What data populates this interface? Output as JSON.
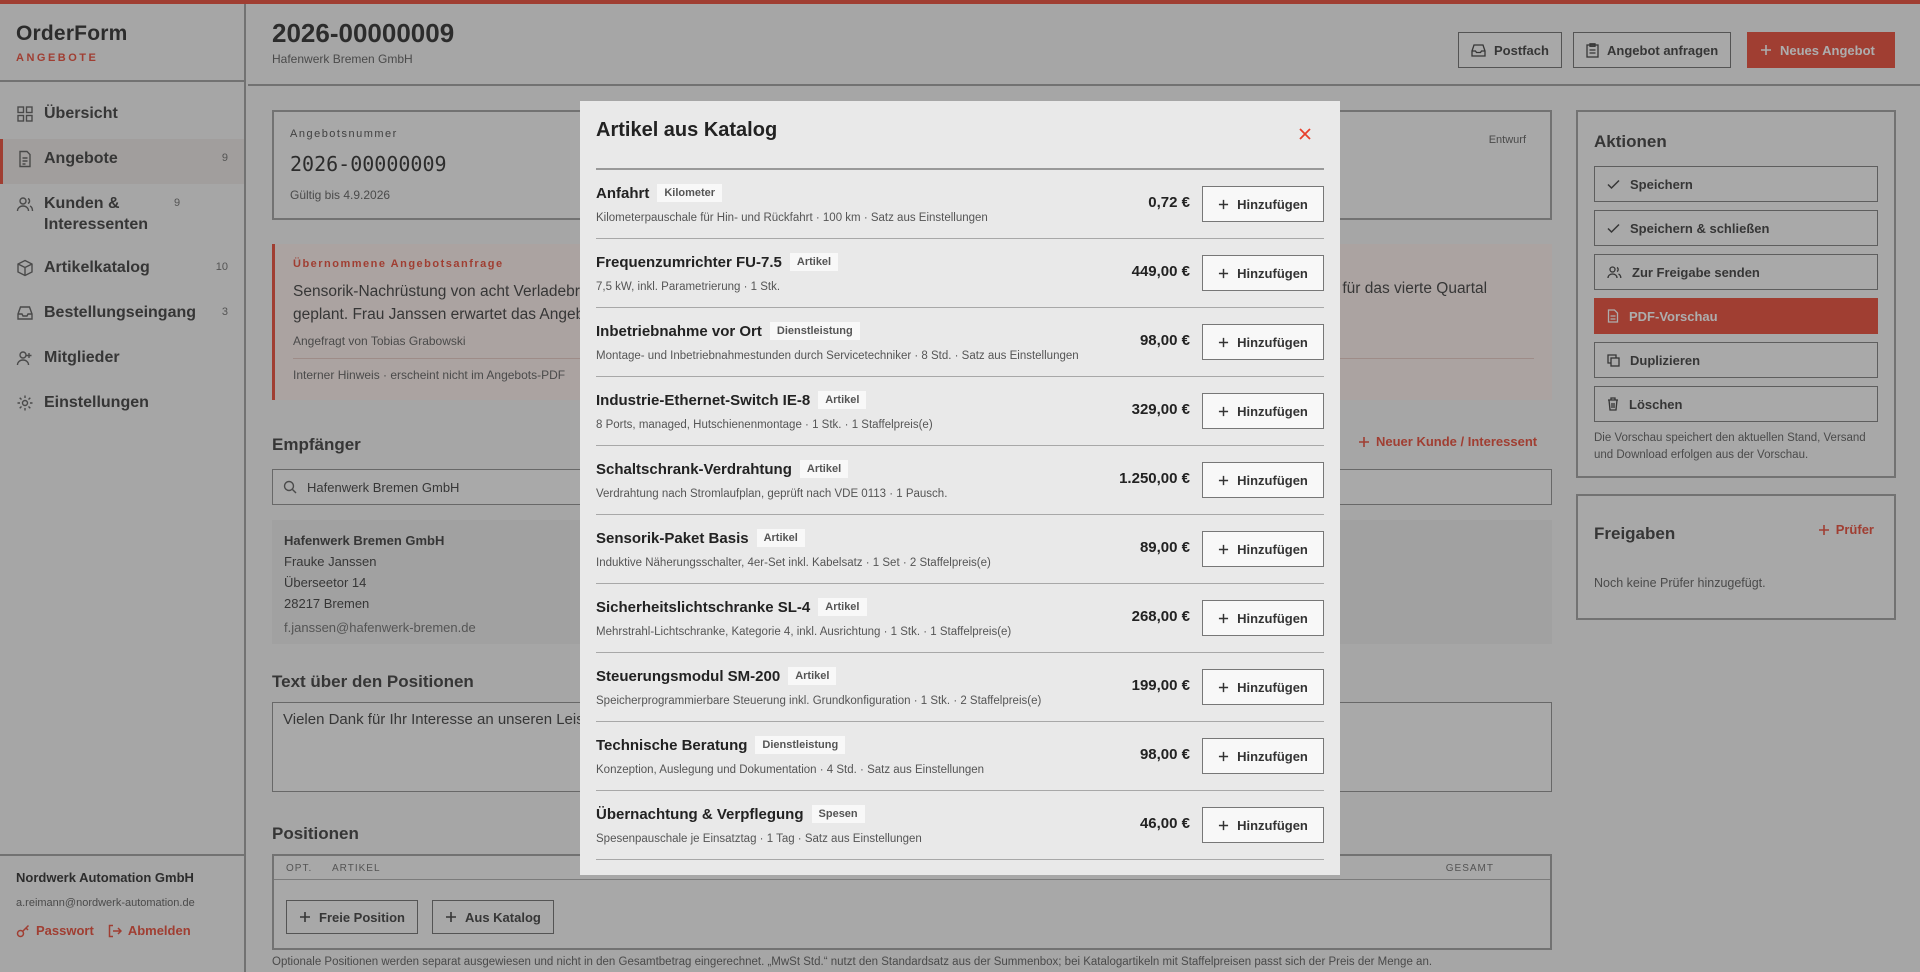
{
  "brand": {
    "title": "OrderForm",
    "subtitle": "ANGEBOTE"
  },
  "nav": [
    {
      "label": "Übersicht",
      "count": "",
      "icon": "grid-icon",
      "active": false
    },
    {
      "label": "Angebote",
      "count": "9",
      "icon": "document-icon",
      "active": true
    },
    {
      "label": "Kunden & Interessenten",
      "count": "9",
      "icon": "users-icon",
      "active": false
    },
    {
      "label": "Artikelkatalog",
      "count": "10",
      "icon": "box-icon",
      "active": false
    },
    {
      "label": "Bestellungseingang",
      "count": "3",
      "icon": "inbox-icon",
      "active": false
    },
    {
      "label": "Mitglieder",
      "count": "",
      "icon": "members-icon",
      "active": false
    },
    {
      "label": "Einstellungen",
      "count": "",
      "icon": "gear-icon",
      "active": false
    }
  ],
  "footer": {
    "company": "Nordwerk Automation GmbH",
    "email": "a.reimann@nordwerk-automation.de",
    "password": "Passwort",
    "logout": "Abmelden"
  },
  "header": {
    "title": "2026-00000009",
    "subtitle": "Hafenwerk Bremen GmbH",
    "btn_inbox": "Postfach",
    "btn_request": "Angebot anfragen",
    "btn_new": "Neues Angebot"
  },
  "offer": {
    "label": "Angebotsnummer",
    "number": "2026-00000009",
    "valid": "Gültig bis 4.9.2026",
    "status": "Entwurf"
  },
  "request": {
    "label": "Übernommene Angebotsanfrage",
    "text_left_1": "Sensorik-Nachrüstung von acht Verladebrü",
    "text_left_2": "geplant. Frau Janssen erwartet das Angebo",
    "text_right_1": "st für das vierte Quartal",
    "by": "Angefragt von Tobias Grabowski",
    "hint": "Interner Hinweis · erscheint nicht im Angebots-PDF"
  },
  "recipient": {
    "title": "Empfänger",
    "new_link": "Neuer Kunde / Interessent",
    "search": "Hafenwerk Bremen GmbH",
    "company": "Hafenwerk Bremen GmbH",
    "person": "Frauke Janssen",
    "street": "Überseetor 14",
    "city": "28217 Bremen",
    "email": "f.janssen@hafenwerk-bremen.de"
  },
  "text_above": {
    "title": "Text über den Positionen",
    "value": "Vielen Dank für Ihr Interesse an unseren Leist"
  },
  "positions": {
    "title": "Positionen",
    "col_opt": "OPT.",
    "col_article": "ARTIKEL",
    "col_total": "GESAMT",
    "btn_free": "Freie Position",
    "btn_catalog": "Aus Katalog",
    "note": "Optionale Positionen werden separat ausgewiesen und nicht in den Gesamtbetrag eingerechnet. „MwSt Std.“ nutzt den Standardsatz aus der Summenbox; bei Katalogartikeln mit Staffelpreisen passt sich der Preis der Menge an."
  },
  "actions": {
    "title": "Aktionen",
    "items": [
      "Speichern",
      "Speichern & schließen",
      "Zur Freigabe senden",
      "PDF-Vorschau",
      "Duplizieren",
      "Löschen"
    ],
    "note": "Die Vorschau speichert den aktuellen Stand, Versand und Download erfolgen aus der Vorschau."
  },
  "approvals": {
    "title": "Freigaben",
    "add": "Prüfer",
    "empty": "Noch keine Prüfer hinzugefügt."
  },
  "modal": {
    "title": "Artikel aus Katalog",
    "add_label": "Hinzufügen",
    "items": [
      {
        "name": "Anfahrt",
        "tag": "Kilometer",
        "desc": "Kilometerpauschale für Hin- und Rückfahrt · 100 km · Satz aus Einstellungen",
        "price": "0,72 €"
      },
      {
        "name": "Frequenzumrichter FU-7.5",
        "tag": "Artikel",
        "desc": "7,5 kW, inkl. Parametrierung · 1 Stk.",
        "price": "449,00 €"
      },
      {
        "name": "Inbetriebnahme vor Ort",
        "tag": "Dienstleistung",
        "desc": "Montage- und Inbetriebnahmestunden durch Servicetechniker · 8 Std. · Satz aus Einstellungen",
        "price": "98,00 €"
      },
      {
        "name": "Industrie-Ethernet-Switch IE-8",
        "tag": "Artikel",
        "desc": "8 Ports, managed, Hutschienenmontage · 1 Stk. · 1 Staffelpreis(e)",
        "price": "329,00 €"
      },
      {
        "name": "Schaltschrank-Verdrahtung",
        "tag": "Artikel",
        "desc": "Verdrahtung nach Stromlaufplan, geprüft nach VDE 0113 · 1 Pausch.",
        "price": "1.250,00 €"
      },
      {
        "name": "Sensorik-Paket Basis",
        "tag": "Artikel",
        "desc": "Induktive Näherungsschalter, 4er-Set inkl. Kabelsatz · 1 Set · 2 Staffelpreis(e)",
        "price": "89,00 €"
      },
      {
        "name": "Sicherheitslichtschranke SL-4",
        "tag": "Artikel",
        "desc": "Mehrstrahl-Lichtschranke, Kategorie 4, inkl. Ausrichtung · 1 Stk. · 1 Staffelpreis(e)",
        "price": "268,00 €"
      },
      {
        "name": "Steuerungsmodul SM-200",
        "tag": "Artikel",
        "desc": "Speicherprogrammierbare Steuerung inkl. Grundkonfiguration · 1 Stk. · 2 Staffelpreis(e)",
        "price": "199,00 €"
      },
      {
        "name": "Technische Beratung",
        "tag": "Dienstleistung",
        "desc": "Konzeption, Auslegung und Dokumentation · 4 Std. · Satz aus Einstellungen",
        "price": "98,00 €"
      },
      {
        "name": "Übernachtung & Verpflegung",
        "tag": "Spesen",
        "desc": "Spesenpauschale je Einsatztag · 1 Tag · Satz aus Einstellungen",
        "price": "46,00 €"
      }
    ]
  },
  "colors": {
    "accent": "#e8402c"
  }
}
